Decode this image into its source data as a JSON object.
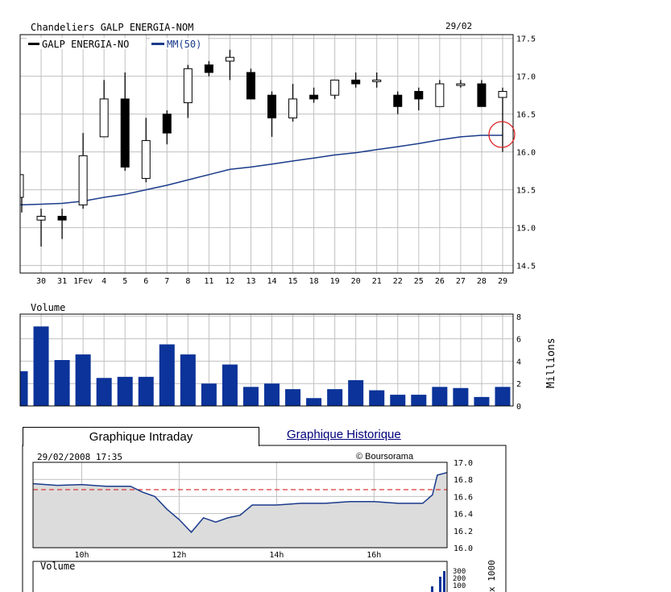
{
  "main_chart": {
    "title": "Chandeliers  GALP ENERGIA-NOM",
    "date": "29/02",
    "legend_candles": "GALP ENERGIA-NO",
    "legend_ma": "MM(50)"
  },
  "volume_chart": {
    "title": "Volume",
    "unit_label": "Millions"
  },
  "tabs": {
    "intraday": "Graphique Intraday",
    "historique": "Graphique Historique"
  },
  "intraday": {
    "datetime": "29/02/2008  17:35",
    "credit": "© Boursorama",
    "volume_title": "Volume",
    "volume_unit": "x 1000"
  },
  "colors": {
    "candle": "#000000",
    "ma": "#1a3a8a",
    "volume_bar": "#0b3399",
    "grid": "#c0c0c0",
    "reference_line": "#dd2222",
    "intraday_fill": "#dcdcdc",
    "marker": "#dd2222"
  },
  "chart_data": [
    {
      "type": "candlestick",
      "title": "Chandeliers  GALP ENERGIA-NOM",
      "categories": [
        "29",
        "30",
        "31",
        "1Fev",
        "4",
        "5",
        "6",
        "7",
        "8",
        "11",
        "12",
        "13",
        "14",
        "15",
        "18",
        "19",
        "20",
        "21",
        "22",
        "25",
        "26",
        "27",
        "28",
        "29"
      ],
      "x_tick_labels": [
        "30",
        "31",
        "1Fev",
        "4",
        "5",
        "6",
        "7",
        "8",
        "11",
        "12",
        "13",
        "14",
        "15",
        "18",
        "19",
        "20",
        "21",
        "22",
        "25",
        "26",
        "27",
        "28",
        "29"
      ],
      "candles": [
        {
          "o": 15.4,
          "h": 15.7,
          "l": 15.2,
          "c": 15.7
        },
        {
          "o": 15.1,
          "h": 15.25,
          "l": 14.75,
          "c": 15.15
        },
        {
          "o": 15.15,
          "h": 15.25,
          "l": 14.85,
          "c": 15.1
        },
        {
          "o": 15.3,
          "h": 16.25,
          "l": 15.25,
          "c": 15.95
        },
        {
          "o": 16.2,
          "h": 16.95,
          "l": 16.2,
          "c": 16.7
        },
        {
          "o": 16.7,
          "h": 17.05,
          "l": 15.75,
          "c": 15.8
        },
        {
          "o": 15.65,
          "h": 16.45,
          "l": 15.6,
          "c": 16.15
        },
        {
          "o": 16.5,
          "h": 16.55,
          "l": 16.1,
          "c": 16.25
        },
        {
          "o": 16.65,
          "h": 17.15,
          "l": 16.45,
          "c": 17.1
        },
        {
          "o": 17.15,
          "h": 17.2,
          "l": 17.0,
          "c": 17.05
        },
        {
          "o": 17.2,
          "h": 17.35,
          "l": 16.95,
          "c": 17.25
        },
        {
          "o": 17.05,
          "h": 17.1,
          "l": 16.7,
          "c": 16.7
        },
        {
          "o": 16.75,
          "h": 16.8,
          "l": 16.2,
          "c": 16.45
        },
        {
          "o": 16.45,
          "h": 16.9,
          "l": 16.4,
          "c": 16.7
        },
        {
          "o": 16.75,
          "h": 16.85,
          "l": 16.65,
          "c": 16.7
        },
        {
          "o": 16.75,
          "h": 16.95,
          "l": 16.7,
          "c": 16.95
        },
        {
          "o": 16.95,
          "h": 17.05,
          "l": 16.85,
          "c": 16.9
        },
        {
          "o": 16.95,
          "h": 17.05,
          "l": 16.85,
          "c": 16.95
        },
        {
          "o": 16.75,
          "h": 16.8,
          "l": 16.5,
          "c": 16.6
        },
        {
          "o": 16.8,
          "h": 16.85,
          "l": 16.55,
          "c": 16.7
        },
        {
          "o": 16.6,
          "h": 16.95,
          "l": 16.6,
          "c": 16.9
        },
        {
          "o": 16.9,
          "h": 16.95,
          "l": 16.85,
          "c": 16.9
        },
        {
          "o": 16.9,
          "h": 16.95,
          "l": 16.6,
          "c": 16.6
        },
        {
          "o": 16.72,
          "h": 16.85,
          "l": 16.0,
          "c": 16.8
        }
      ],
      "moving_average": {
        "name": "MM(50)",
        "values": [
          15.3,
          15.31,
          15.32,
          15.35,
          15.4,
          15.44,
          15.5,
          15.56,
          15.63,
          15.7,
          15.77,
          15.8,
          15.84,
          15.88,
          15.92,
          15.96,
          15.99,
          16.03,
          16.07,
          16.11,
          16.16,
          16.2,
          16.22,
          16.22
        ]
      },
      "y_ticks": [
        14.5,
        15.0,
        15.5,
        16.0,
        16.5,
        17.0,
        17.5
      ],
      "ylim": [
        14.4,
        17.55
      ],
      "legend": [
        "GALP ENERGIA-NO",
        "MM(50)"
      ]
    },
    {
      "type": "bar",
      "title": "Volume",
      "ylabel": "Millions",
      "categories": [
        "29",
        "30",
        "31",
        "1Fev",
        "4",
        "5",
        "6",
        "7",
        "8",
        "11",
        "12",
        "13",
        "14",
        "15",
        "18",
        "19",
        "20",
        "21",
        "22",
        "25",
        "26",
        "27",
        "28",
        "29"
      ],
      "values": [
        3.1,
        7.1,
        4.1,
        4.6,
        2.5,
        2.6,
        2.6,
        5.5,
        4.6,
        2.0,
        3.7,
        1.7,
        2.0,
        1.5,
        0.7,
        1.5,
        2.3,
        1.4,
        1.0,
        1.0,
        1.7,
        1.6,
        0.8,
        1.7
      ],
      "y_ticks": [
        0,
        2,
        4,
        6,
        8
      ],
      "ylim": [
        0,
        8.2
      ]
    },
    {
      "type": "area",
      "title": "Graphique Intraday",
      "subtitle": "29/02/2008  17:35",
      "x_ticks": [
        "10h",
        "12h",
        "14h",
        "16h"
      ],
      "x": [
        9.0,
        9.5,
        10.0,
        10.5,
        11.0,
        11.25,
        11.5,
        11.75,
        12.0,
        12.25,
        12.5,
        12.75,
        13.0,
        13.25,
        13.5,
        14.0,
        14.5,
        15.0,
        15.5,
        16.0,
        16.5,
        17.0,
        17.2,
        17.3,
        17.5
      ],
      "values": [
        16.75,
        16.73,
        16.74,
        16.72,
        16.72,
        16.65,
        16.6,
        16.45,
        16.33,
        16.18,
        16.35,
        16.3,
        16.35,
        16.38,
        16.5,
        16.5,
        16.52,
        16.52,
        16.54,
        16.54,
        16.52,
        16.52,
        16.62,
        16.85,
        16.88
      ],
      "reference_line": 16.68,
      "y_ticks": [
        16.0,
        16.2,
        16.4,
        16.6,
        16.8,
        17.0
      ],
      "ylim": [
        16.0,
        17.0
      ],
      "xlim": [
        9.0,
        17.5
      ]
    }
  ]
}
